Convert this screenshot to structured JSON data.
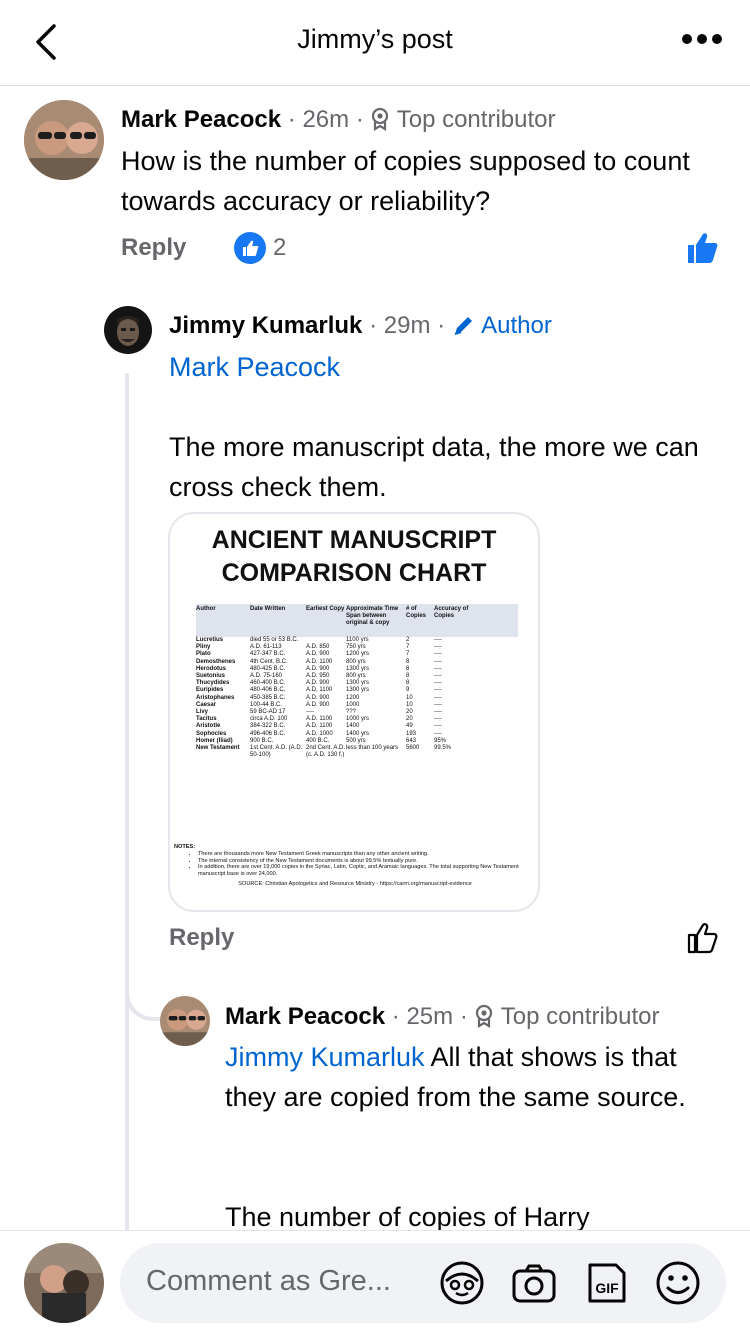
{
  "header": {
    "title": "Jimmy’s post"
  },
  "comments": [
    {
      "name": "Mark Peacock",
      "time": "26m",
      "badge": "Top contributor",
      "text": "How is the number of copies supposed to count towards accuracy or reliability?",
      "reply_label": "Reply",
      "like_count": "2"
    },
    {
      "name": "Jimmy Kumarluk",
      "time": "29m",
      "badge": "Author",
      "mention": "Mark Peacock",
      "text": "The more manuscript data, the more we can cross check them.",
      "reply_label": "Reply"
    },
    {
      "name": "Mark Peacock",
      "time": "25m",
      "badge": "Top contributor",
      "mention": "Jimmy Kumarluk",
      "text": "All that shows is that they are copied from the same source.",
      "text2": "The number of copies of Harry"
    }
  ],
  "separator": "·",
  "chart_image": {
    "title_line1": "ANCIENT MANUSCRIPT",
    "title_line2": "COMPARISON CHART",
    "columns": [
      "Author",
      "Date Written",
      "Earliest Copy",
      "Approximate Time Span between original & copy",
      "# of Copies",
      "Accuracy of Copies"
    ],
    "rows": [
      [
        "Lucretius",
        "died 55 or 53 B.C.",
        "",
        "1100 yrs",
        "2",
        "----"
      ],
      [
        "Pliny",
        "A.D. 61-113",
        "A.D. 850",
        "750 yrs",
        "7",
        "----"
      ],
      [
        "Plato",
        "427-347 B.C.",
        "A.D. 900",
        "1200 yrs",
        "7",
        "----"
      ],
      [
        "Demosthenes",
        "4th Cent. B.C.",
        "A.D. 1100",
        "800 yrs",
        "8",
        "----"
      ],
      [
        "Herodotus",
        "480-425 B.C.",
        "A.D. 900",
        "1300 yrs",
        "8",
        "----"
      ],
      [
        "Suetonius",
        "A.D. 75-160",
        "A.D. 950",
        "800 yrs",
        "8",
        "----"
      ],
      [
        "Thucydides",
        "460-400 B.C.",
        "A.D. 900",
        "1300 yrs",
        "8",
        "----"
      ],
      [
        "Euripides",
        "480-406 B.C.",
        "A.D. 1100",
        "1300 yrs",
        "9",
        "----"
      ],
      [
        "Aristophanes",
        "450-385 B.C.",
        "A.D. 900",
        "1200",
        "10",
        "----"
      ],
      [
        "Caesar",
        "100-44 B.C.",
        "A.D. 900",
        "1000",
        "10",
        "----"
      ],
      [
        "Livy",
        "59 BC-AD 17",
        "----",
        "???",
        "20",
        "----"
      ],
      [
        "Tacitus",
        "circa A.D. 100",
        "A.D. 1100",
        "1000 yrs",
        "20",
        "----"
      ],
      [
        "Aristotle",
        "384-322 B.C.",
        "A.D. 1100",
        "1400",
        "49",
        "----"
      ],
      [
        "Sophocles",
        "496-406 B.C.",
        "A.D. 1000",
        "1400 yrs",
        "193",
        "----"
      ],
      [
        "Homer (Iliad)",
        "900 B.C.",
        "400 B.C.",
        "500 yrs",
        "643",
        "95%"
      ],
      [
        "New Testament",
        "1st Cent. A.D. (A.D. 50-100)",
        "2nd Cent. A.D. (c. A.D. 130 f.)",
        "less than 100 years",
        "5600",
        "99.5%"
      ]
    ],
    "notes_heading": "NOTES:",
    "notes": [
      "There are thousands more New Testament Greek manuscripts than any other ancient writing.",
      "The internal consistency of the New Testament documents is about 99.5% textually pure.",
      "In addition, there are over 19,000 copies in the Syriac, Latin, Coptic, and Aramaic languages. The total supporting New Testament manuscript base is over 24,000."
    ],
    "source": "SOURCE: Christian Apologetics and Resource Ministry - https://carm.org/manuscript-evidence"
  },
  "composer": {
    "placeholder": "Comment as Gre..."
  },
  "colors": {
    "link": "#0064d1",
    "like_blue": "#1877f2",
    "secondary_text": "#65676b"
  }
}
